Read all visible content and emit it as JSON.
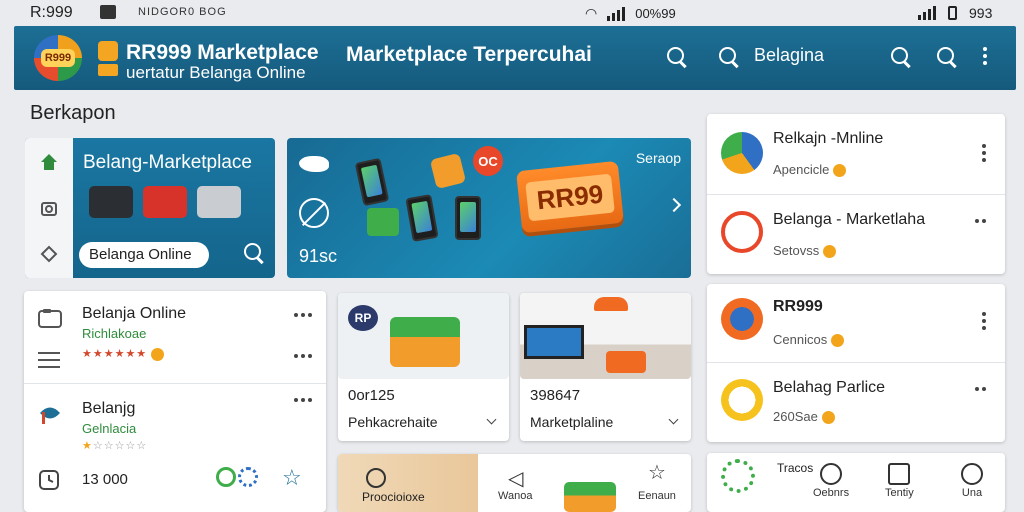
{
  "status_bar": {
    "time": "R:999",
    "notif_text": "NIDGOR0 BOG",
    "center_text": "00%99",
    "right_text": "993"
  },
  "app_bar": {
    "logo_text": "R999",
    "title": "RR999 Marketplace",
    "subtitle": "uertatur Belanga Online",
    "center_title": "Marketplace Terpercuhai",
    "search_label": "Belagina"
  },
  "section_title": "Berkapon",
  "promo_left": {
    "title": "Belang-Marketplace",
    "pill_text": "Belanga Online"
  },
  "promo_right": {
    "tag": "Seraop",
    "badge": "OC",
    "box_label": "RR99",
    "subtext": "91sc"
  },
  "left_list": {
    "items": [
      {
        "title": "Belanja Online",
        "subtitle": "Richlakoae"
      },
      {
        "title": "Belanjg",
        "subtitle": "Gelnlacia"
      }
    ],
    "footer_value": "13 000"
  },
  "product_tiles": [
    {
      "price": "0or125",
      "name": "Pehkacrehaite",
      "badge": "RP"
    },
    {
      "price": "398647",
      "name": "Marketplaline"
    }
  ],
  "bottom_tiles": [
    {
      "label": "Proocioioxe"
    },
    {
      "label": "Wanoa"
    },
    {
      "label": "Eenaun"
    }
  ],
  "right_list": {
    "cards": [
      [
        {
          "title": "Relkajn -Mnline",
          "subtitle": "Apencicle"
        },
        {
          "title": "Belanga - Marketlaha",
          "subtitle": "Setovss"
        }
      ],
      [
        {
          "title": "RR999",
          "subtitle": "Cennicos"
        },
        {
          "title": "Belahag Parlice",
          "subtitle": "260Sae"
        }
      ]
    ]
  },
  "bottom_nav": {
    "items": [
      {
        "label": "Tracos"
      },
      {
        "label": "Oebnrs"
      },
      {
        "label": "Tentiy"
      },
      {
        "label": "Una"
      }
    ]
  },
  "colors": {
    "primary": "#1d6f95",
    "accent": "#f2a51b",
    "danger": "#d3472c",
    "success": "#2f8c3c"
  }
}
